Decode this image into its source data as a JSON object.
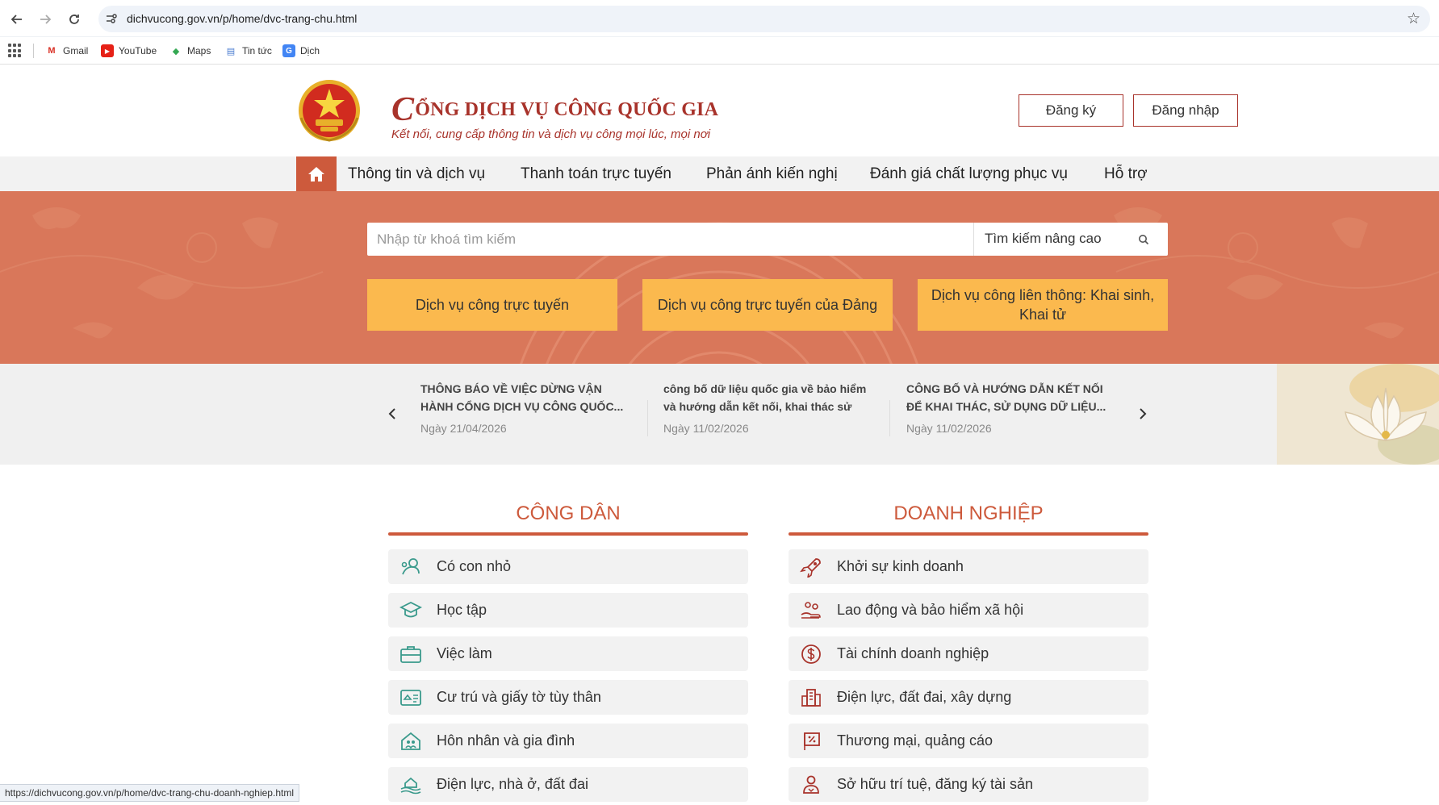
{
  "browser": {
    "url": "dichvucong.gov.vn/p/home/dvc-trang-chu.html",
    "bookmarks": [
      {
        "label": "Gmail",
        "icon": "gmail-icon"
      },
      {
        "label": "YouTube",
        "icon": "youtube-icon"
      },
      {
        "label": "Maps",
        "icon": "maps-icon"
      },
      {
        "label": "Tin tức",
        "icon": "news-icon"
      },
      {
        "label": "Dịch",
        "icon": "translate-icon"
      }
    ],
    "status_url": "https://dichvucong.gov.vn/p/home/dvc-trang-chu-doanh-nghiep.html"
  },
  "header": {
    "title_initial": "C",
    "title_rest": "ỔNG DỊCH VỤ CÔNG QUỐC GIA",
    "slogan": "Kết nối, cung cấp thông tin và dịch vụ công mọi lúc, mọi nơi",
    "register_label": "Đăng ký",
    "login_label": "Đăng nhập"
  },
  "nav": {
    "items": [
      "Thông tin và dịch vụ",
      "Thanh toán trực tuyến",
      "Phản ánh kiến nghị",
      "Đánh giá chất lượng phục vụ",
      "Hỗ trợ"
    ]
  },
  "search": {
    "placeholder": "Nhập từ khoá tìm kiếm",
    "advanced_label": "Tìm kiếm nâng cao"
  },
  "hero_buttons": [
    "Dịch vụ công trực tuyến",
    "Dịch vụ công trực tuyến của Đảng",
    "Dịch vụ công liên thông: Khai sinh, Khai tử"
  ],
  "news": [
    {
      "title": "THÔNG BÁO VỀ VIỆC DỪNG VẬN HÀNH CỔNG DỊCH VỤ CÔNG QUỐC...",
      "date": "Ngày 21/04/2026"
    },
    {
      "title": "công bố dữ liệu quốc gia về bảo hiểm và hướng dẫn kết nối, khai thác sử dụng ...",
      "date": "Ngày 11/02/2026"
    },
    {
      "title": "CÔNG BỐ VÀ HƯỚNG DẪN KẾT NỐI ĐỂ KHAI THÁC, SỬ DỤNG DỮ LIỆU...",
      "date": "Ngày 11/02/2026"
    }
  ],
  "citizen": {
    "heading": "CÔNG DÂN",
    "items": [
      {
        "label": "Có con nhỏ",
        "icon": "baby-icon"
      },
      {
        "label": "Học tập",
        "icon": "graduation-cap-icon"
      },
      {
        "label": "Việc làm",
        "icon": "briefcase-icon"
      },
      {
        "label": "Cư trú và giấy tờ tùy thân",
        "icon": "id-card-icon"
      },
      {
        "label": "Hôn nhân và gia đình",
        "icon": "family-home-icon"
      },
      {
        "label": "Điện lực, nhà ở, đất đai",
        "icon": "land-house-icon"
      }
    ]
  },
  "business": {
    "heading": "DOANH NGHIỆP",
    "items": [
      {
        "label": "Khởi sự kinh doanh",
        "icon": "rocket-icon"
      },
      {
        "label": "Lao động và bảo hiểm xã hội",
        "icon": "labor-insurance-icon"
      },
      {
        "label": "Tài chính doanh nghiệp",
        "icon": "dollar-coin-icon"
      },
      {
        "label": "Điện lực, đất đai, xây dựng",
        "icon": "building-icon"
      },
      {
        "label": "Thương mại, quảng cáo",
        "icon": "discount-board-icon"
      },
      {
        "label": "Sở hữu trí tuệ, đăng ký tài sản",
        "icon": "ip-person-icon"
      }
    ]
  },
  "colors": {
    "brand_red": "#a8332b",
    "accent_orange": "#cd5a3c",
    "hero_bg": "#d9775a",
    "hero_button": "#fbb94e",
    "citizen_icon": "#3a9a8c"
  }
}
